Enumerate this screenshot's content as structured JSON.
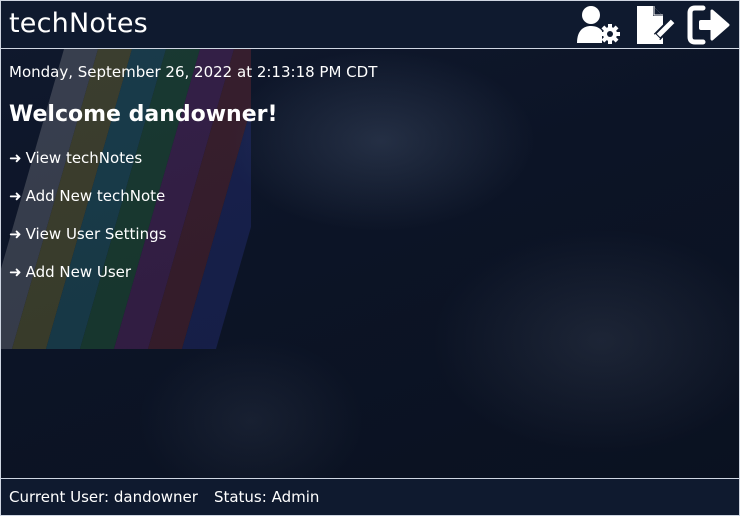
{
  "app": {
    "title": "techNotes"
  },
  "header_icons": [
    {
      "name": "user-settings-icon"
    },
    {
      "name": "new-note-icon"
    },
    {
      "name": "logout-icon"
    }
  ],
  "main": {
    "datetime": "Monday, September 26, 2022 at 2:13:18 PM CDT",
    "welcome": "Welcome dandowner!",
    "links": [
      {
        "arrow": "➜",
        "label": "View techNotes"
      },
      {
        "arrow": "➜",
        "label": "Add New techNote"
      },
      {
        "arrow": "➜",
        "label": "View User Settings"
      },
      {
        "arrow": "➜",
        "label": "Add New User"
      }
    ]
  },
  "footer": {
    "current_user": "Current User: dandowner",
    "status": "Status: Admin"
  },
  "colors": {
    "background": "#0b1120",
    "header": "#0f1a2f",
    "text": "#ffffff",
    "border": "#cfd6e2"
  }
}
